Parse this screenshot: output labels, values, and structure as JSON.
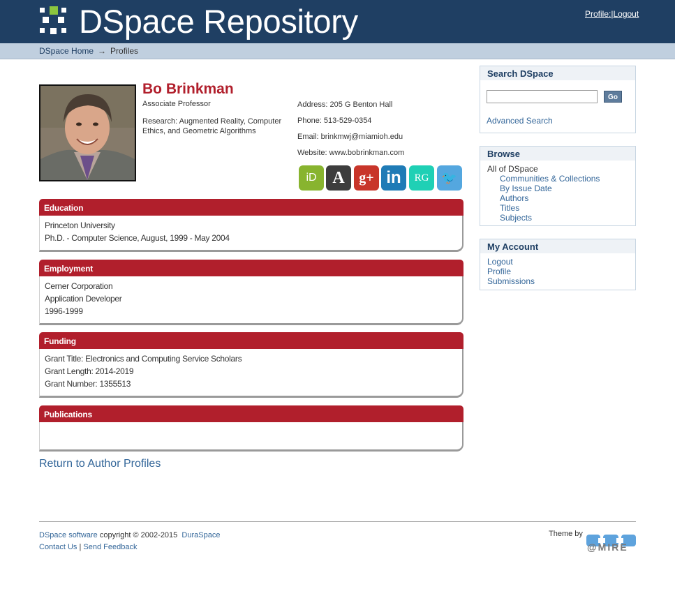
{
  "header": {
    "site_title": "DSpace Repository",
    "profile_link": "Profile:",
    "separator": "|",
    "logout_link": "Logout"
  },
  "trail": {
    "home": "DSpace Home",
    "arrow": "→",
    "current": "Profiles"
  },
  "profile": {
    "name": "Bo Brinkman",
    "title": "Associate Professor",
    "research": "Research: Augmented Reality, Computer Ethics, and Geometric Algorithms",
    "address": "Address: 205 G Benton Hall",
    "phone": "Phone: 513-529-0354",
    "email": "Email: brinkmwj@miamioh.edu",
    "website": "Website: www.bobrinkman.com",
    "social": [
      {
        "name": "orcid-icon",
        "glyph": "iD",
        "color": "#88b42f"
      },
      {
        "name": "academia-icon",
        "glyph": "A",
        "color": "#3d3d3d"
      },
      {
        "name": "google-plus-icon",
        "glyph": "g+",
        "color": "#c8352a"
      },
      {
        "name": "linkedin-icon",
        "glyph": "in",
        "color": "#1f7bb6"
      },
      {
        "name": "researchgate-icon",
        "glyph": "RG",
        "color": "#1fd0b5"
      },
      {
        "name": "twitter-icon",
        "glyph": "🐦",
        "color": "#54a7df"
      }
    ]
  },
  "sections": {
    "education": {
      "heading": "Education",
      "lines": [
        "Princeton University",
        "Ph.D. - Computer Science, August, 1999 - May 2004"
      ]
    },
    "employment": {
      "heading": "Employment",
      "lines": [
        "Cerner Corporation",
        "Application Developer",
        "1996-1999"
      ]
    },
    "funding": {
      "heading": "Funding",
      "lines": [
        "Grant Title: Electronics and Computing Service Scholars",
        "Grant Length: 2014-2019",
        "Grant Number: 1355513"
      ]
    },
    "publications": {
      "heading": "Publications",
      "lines": []
    }
  },
  "return_link": "Return to Author Profiles",
  "sidebar": {
    "search": {
      "heading": "Search DSpace",
      "input_value": "",
      "go_label": "Go",
      "advanced": "Advanced Search"
    },
    "browse": {
      "heading": "Browse",
      "scope": "All of DSpace",
      "links": [
        "Communities & Collections",
        "By Issue Date",
        "Authors",
        "Titles",
        "Subjects"
      ]
    },
    "account": {
      "heading": "My Account",
      "links": [
        "Logout",
        "Profile",
        "Submissions"
      ]
    }
  },
  "footer": {
    "software_link": "DSpace software",
    "copyright": "copyright © 2002-2015",
    "duraspace_link": "DuraSpace",
    "contact_link": "Contact Us",
    "separator": "|",
    "feedback_link": "Send Feedback",
    "theme_by": "Theme by",
    "mire_text": "@MIRE"
  },
  "colors": {
    "header_bg": "#1f3f63",
    "accent_red": "#b11f2c",
    "logo_green": "#8cc63f"
  }
}
